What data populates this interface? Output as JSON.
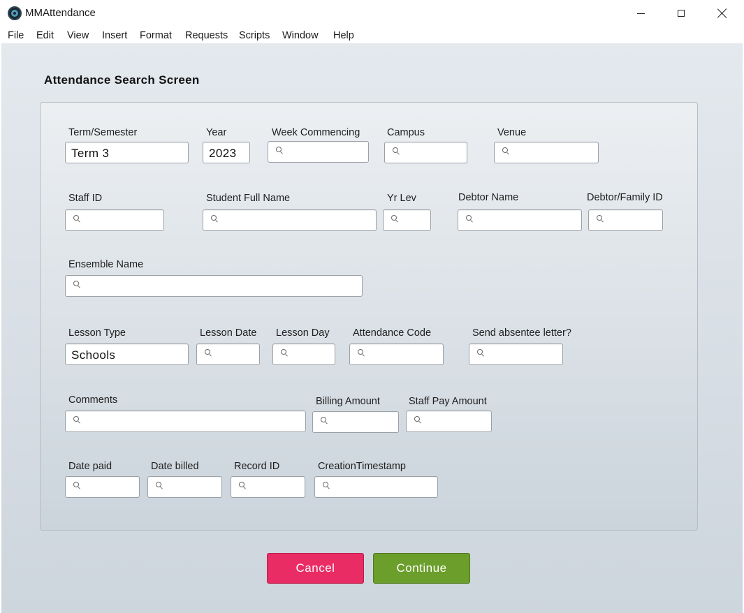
{
  "window": {
    "title": "MMAttendance"
  },
  "menu": [
    "File",
    "Edit",
    "View",
    "Insert",
    "Format",
    "Requests",
    "Scripts",
    "Window",
    "Help"
  ],
  "screen": {
    "title": "Attendance Search Screen"
  },
  "fields": {
    "term_semester": {
      "label": "Term/Semester",
      "value": "Term 3"
    },
    "year": {
      "label": "Year",
      "value": "2023"
    },
    "week_commencing": {
      "label": "Week Commencing",
      "value": ""
    },
    "campus": {
      "label": "Campus",
      "value": ""
    },
    "venue": {
      "label": "Venue",
      "value": ""
    },
    "staff_id": {
      "label": "Staff ID",
      "value": ""
    },
    "student_full_name": {
      "label": "Student Full Name",
      "value": ""
    },
    "yr_lev": {
      "label": "Yr Lev",
      "value": ""
    },
    "debtor_name": {
      "label": "Debtor Name",
      "value": ""
    },
    "debtor_family_id": {
      "label": "Debtor/Family ID",
      "value": ""
    },
    "ensemble_name": {
      "label": "Ensemble Name",
      "value": ""
    },
    "lesson_type": {
      "label": "Lesson Type",
      "value": "Schools"
    },
    "lesson_date": {
      "label": "Lesson Date",
      "value": ""
    },
    "lesson_day": {
      "label": "Lesson Day",
      "value": ""
    },
    "attendance_code": {
      "label": "Attendance Code",
      "value": ""
    },
    "send_absentee_letter": {
      "label": "Send absentee letter?",
      "value": ""
    },
    "comments": {
      "label": "Comments",
      "value": ""
    },
    "billing_amount": {
      "label": "Billing Amount",
      "value": ""
    },
    "staff_pay_amount": {
      "label": "Staff Pay Amount",
      "value": ""
    },
    "date_paid": {
      "label": "Date paid",
      "value": ""
    },
    "date_billed": {
      "label": "Date billed",
      "value": ""
    },
    "record_id": {
      "label": "Record ID",
      "value": ""
    },
    "creation_timestamp": {
      "label": "CreationTimestamp",
      "value": ""
    }
  },
  "buttons": {
    "cancel": "Cancel",
    "continue": "Continue"
  },
  "colors": {
    "cancel": "#ea2c64",
    "continue": "#6b9e2b"
  }
}
